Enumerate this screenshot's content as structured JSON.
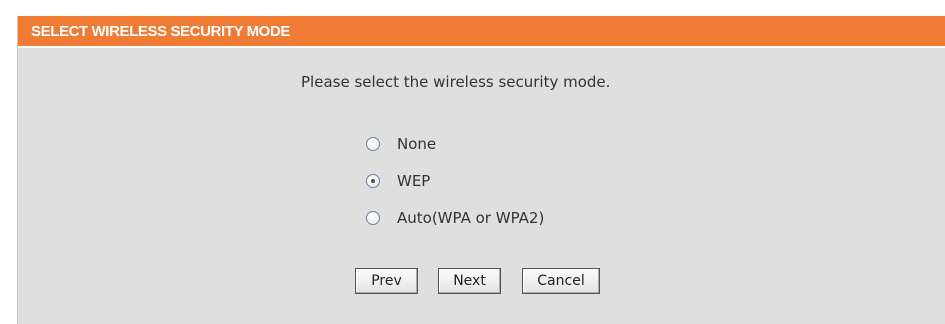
{
  "header": {
    "title": "SELECT WIRELESS SECURITY MODE"
  },
  "instruction": "Please select the wireless security mode.",
  "options": [
    {
      "label": "None",
      "selected": false
    },
    {
      "label": "WEP",
      "selected": true
    },
    {
      "label": "Auto(WPA or WPA2)",
      "selected": false
    }
  ],
  "buttons": {
    "prev": "Prev",
    "next": "Next",
    "cancel": "Cancel"
  },
  "colors": {
    "header_bg": "#ef7b35",
    "panel_bg": "#dfdfdf"
  }
}
